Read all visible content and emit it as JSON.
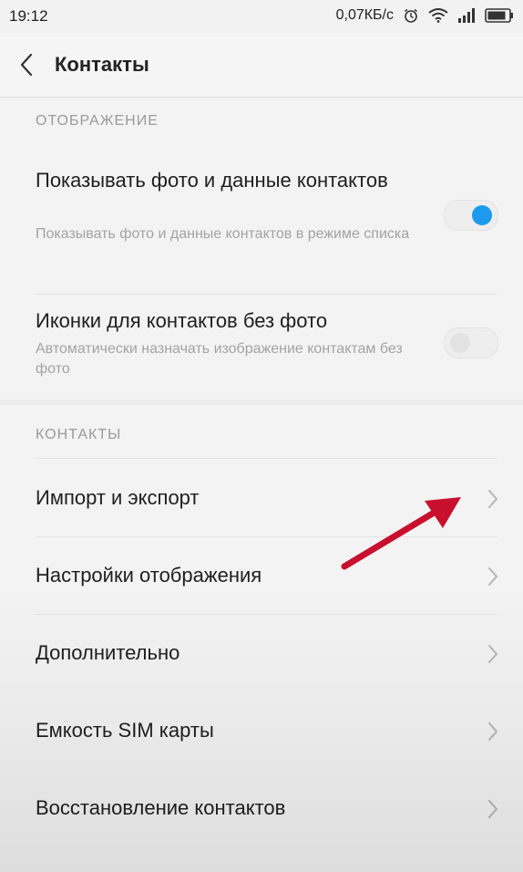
{
  "status_bar": {
    "time": "19:12",
    "network_speed": "0,07КБ/с",
    "icons": [
      "alarm-icon",
      "wifi-icon",
      "signal-icon",
      "battery-icon"
    ]
  },
  "app_bar": {
    "back_icon": "chevron-left-icon",
    "title": "Контакты"
  },
  "sections": {
    "display": {
      "header": "ОТОБРАЖЕНИЕ",
      "items": [
        {
          "label": "Показывать фото и данные контактов",
          "description": "Показывать фото и данные контактов в режиме списка",
          "toggle_state": "on"
        },
        {
          "label": "Иконки для контактов без фото",
          "description": "Автоматически назначать изображение контактам без фото",
          "toggle_state": "off"
        }
      ]
    },
    "contacts": {
      "header": "КОНТАКТЫ",
      "items": [
        {
          "label": "Импорт и экспорт"
        },
        {
          "label": "Настройки отображения"
        },
        {
          "label": "Дополнительно"
        },
        {
          "label": "Емкость SIM карты"
        },
        {
          "label": "Восстановление контактов"
        }
      ]
    }
  },
  "colors": {
    "accent": "#1d9aee",
    "annotation_arrow": "#c8102e"
  }
}
